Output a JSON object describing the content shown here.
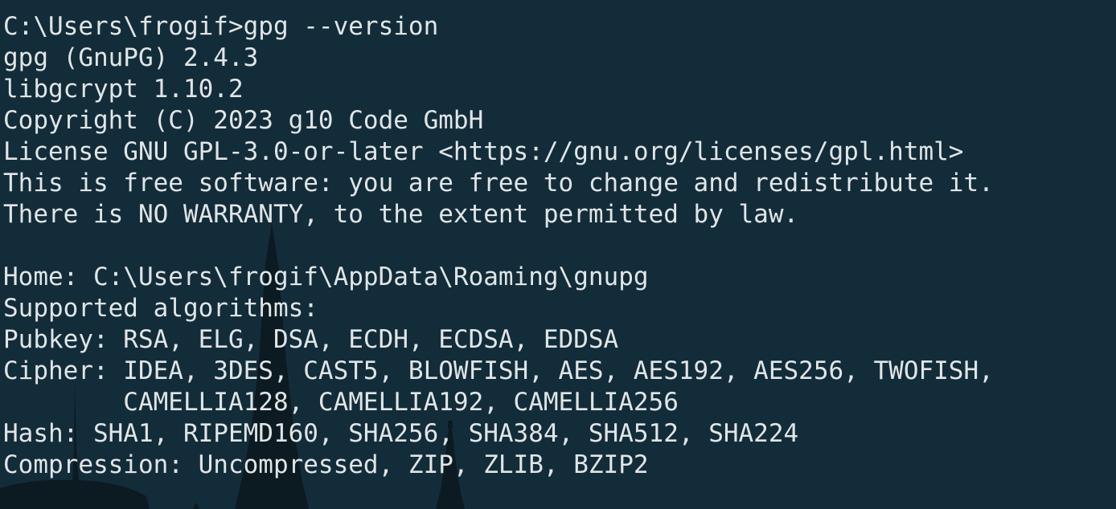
{
  "terminal": {
    "background_color": "#132c3a",
    "text_color": "#e1e5e6",
    "lines": [
      "C:\\Users\\frogif>gpg --version",
      "gpg (GnuPG) 2.4.3",
      "libgcrypt 1.10.2",
      "Copyright (C) 2023 g10 Code GmbH",
      "License GNU GPL-3.0-or-later <https://gnu.org/licenses/gpl.html>",
      "This is free software: you are free to change and redistribute it.",
      "There is NO WARRANTY, to the extent permitted by law.",
      "",
      "Home: C:\\Users\\frogif\\AppData\\Roaming\\gnupg",
      "Supported algorithms:",
      "Pubkey: RSA, ELG, DSA, ECDH, ECDSA, EDDSA",
      "Cipher: IDEA, 3DES, CAST5, BLOWFISH, AES, AES192, AES256, TWOFISH,",
      "        CAMELLIA128, CAMELLIA192, CAMELLIA256",
      "Hash: SHA1, RIPEMD160, SHA256, SHA384, SHA512, SHA224",
      "Compression: Uncompressed, ZIP, ZLIB, BZIP2"
    ]
  }
}
